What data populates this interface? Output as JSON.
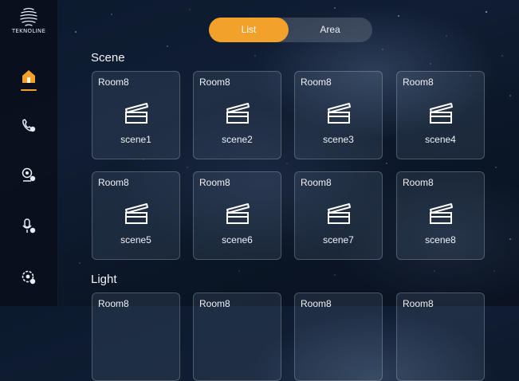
{
  "brand": {
    "logo_text": "TEKNOLINE"
  },
  "sidebar": {
    "items": [
      {
        "icon": "home-icon",
        "active": true
      },
      {
        "icon": "phone-icon",
        "active": false
      },
      {
        "icon": "camera-icon",
        "active": false
      },
      {
        "icon": "microphone-icon",
        "active": false
      },
      {
        "icon": "settings-icon",
        "active": false
      }
    ]
  },
  "toggle": {
    "list_label": "List",
    "area_label": "Area",
    "selected": "List"
  },
  "scene_section": {
    "title": "Scene",
    "cards": [
      {
        "room": "Room8",
        "name": "scene1"
      },
      {
        "room": "Room8",
        "name": "scene2"
      },
      {
        "room": "Room8",
        "name": "scene3"
      },
      {
        "room": "Room8",
        "name": "scene4"
      },
      {
        "room": "Room8",
        "name": "scene5"
      },
      {
        "room": "Room8",
        "name": "scene6"
      },
      {
        "room": "Room8",
        "name": "scene7"
      },
      {
        "room": "Room8",
        "name": "scene8"
      }
    ]
  },
  "light_section": {
    "title": "Light",
    "cards": [
      {
        "room": "Room8"
      },
      {
        "room": "Room8"
      },
      {
        "room": "Room8"
      },
      {
        "room": "Room8"
      }
    ]
  },
  "colors": {
    "accent": "#f2a22a",
    "card_border": "#8a9ab0",
    "background": "#0c1a2e"
  }
}
